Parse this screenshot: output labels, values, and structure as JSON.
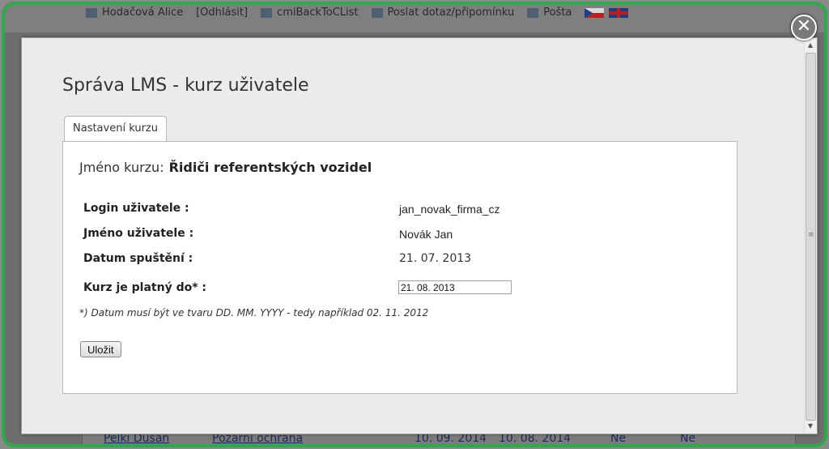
{
  "background": {
    "top_bar": {
      "user_name": "Hodačová Alice",
      "logout": "[Odhlásit]",
      "back_link": "cmiBackToCList",
      "feedback": "Poslat dotaz/připomínku",
      "mail": "Pošta"
    },
    "table_row": {
      "name": "Pelki Dušan",
      "course": "Požární ochrana",
      "date_from": "10. 09. 2014",
      "date_to": "10. 08. 2014",
      "col5": "Ne",
      "col6": "Ne"
    }
  },
  "modal": {
    "close_symbol": "✕",
    "title": "Správa LMS - kurz uživatele",
    "tab_label": "Nastavení kurzu",
    "course_label": "Jméno kurzu:",
    "course_name": "Řidiči referentských vozidel",
    "fields": {
      "login_label": "Login uživatele :",
      "login_value": "jan_novak_firma_cz",
      "name_label": "Jméno uživatele :",
      "name_value": "Novák Jan",
      "start_label": "Datum spuštění :",
      "start_value": "21. 07. 2013",
      "valid_label": "Kurz je platný do* :",
      "valid_value": "21. 08. 2013"
    },
    "note": "*) Datum musí být ve tvaru DD. MM. YYYY - tedy například 02. 11. 2012",
    "save_label": "Uložit"
  },
  "colors": {
    "frame": "#2eaa4a"
  }
}
